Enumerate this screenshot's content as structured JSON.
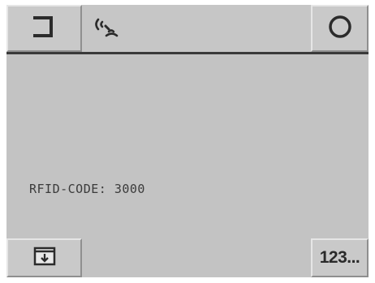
{
  "top_bar": {
    "exit_icon": "exit-bracket-icon",
    "rf_icon": "rfid-signal-icon",
    "power_icon": "circle-icon"
  },
  "main": {
    "rfid_line": "RFID-CODE: 3000"
  },
  "bottom_bar": {
    "save_icon": "save-download-icon",
    "keypad_label": "123..."
  },
  "colors": {
    "screen_bg": "#c3c3c3",
    "button_bg": "#c9c9c9",
    "text": "#3b3b3b"
  }
}
